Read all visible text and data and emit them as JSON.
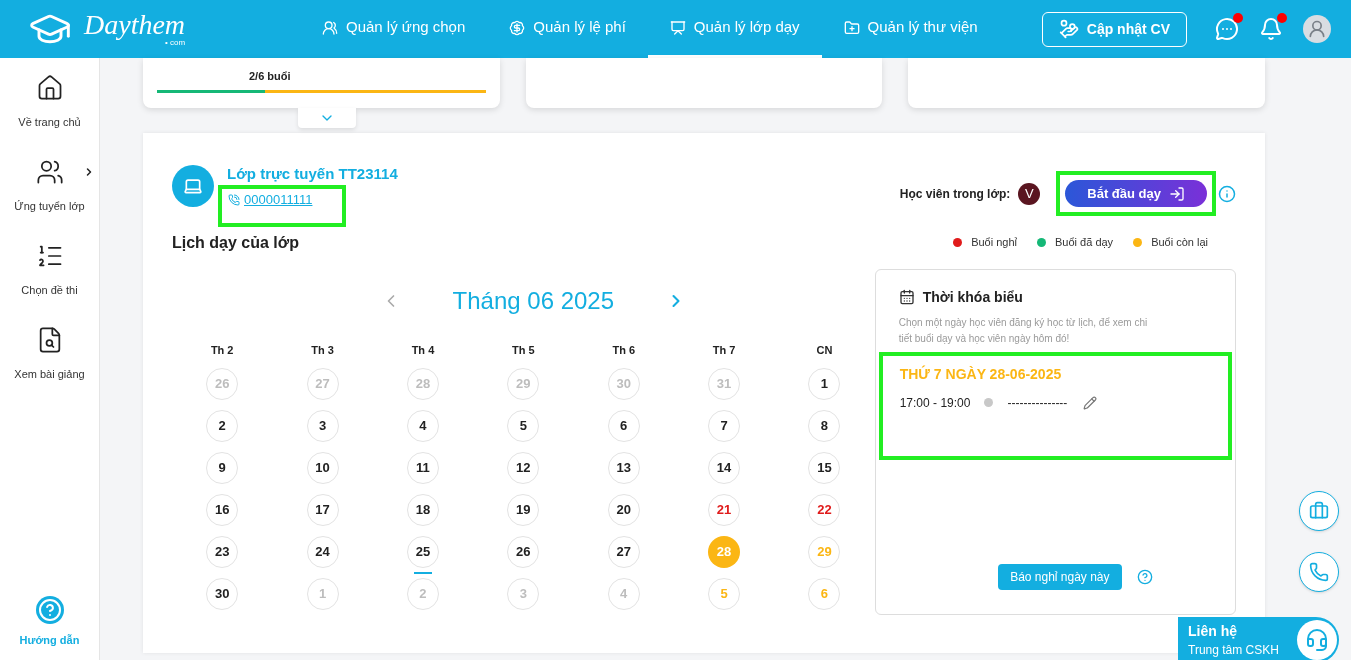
{
  "header": {
    "logo": "Daythem",
    "logo_suffix": "• com",
    "nav": [
      {
        "label": "Quản lý ứng chọn",
        "selected": false
      },
      {
        "label": "Quản lý lệ phí",
        "selected": false
      },
      {
        "label": "Quản lý lớp dạy",
        "selected": true
      },
      {
        "label": "Quản lý thư viện",
        "selected": false
      }
    ],
    "cv_button": "Cập nhật CV",
    "chat_unread": true,
    "bell_unread": true
  },
  "sidebar": {
    "items": [
      {
        "label": "Về trang chủ",
        "expandable": false
      },
      {
        "label": "Ứng tuyển lớp",
        "expandable": true
      },
      {
        "label": "Chọn đề thi",
        "expandable": false
      },
      {
        "label": "Xem bài giảng",
        "expandable": false
      }
    ],
    "help": "Hướng dẫn"
  },
  "top_cards": [
    {
      "kind": "progress",
      "label": "2/6 buổi",
      "level": 0.33
    },
    {
      "kind": "empty"
    },
    {
      "kind": "empty"
    }
  ],
  "class": {
    "title": "Lớp trực tuyến TT23114",
    "phone": "0000011111",
    "phone_highlighted": true,
    "students_label": "Học viên trong lớp:",
    "students": [
      {
        "initial": "V",
        "color": "#5a1520"
      }
    ],
    "start_button": "Bắt đầu dạy",
    "start_highlighted": true
  },
  "schedule": {
    "title": "Lịch dạy của lớp",
    "legend": [
      {
        "label": "Buổi nghỉ",
        "color": "#e01b1b"
      },
      {
        "label": "Buổi đã dạy",
        "color": "#15b877"
      },
      {
        "label": "Buổi còn lại",
        "color": "#fbb614"
      }
    ],
    "month": "Tháng 06 2025",
    "weekdays": [
      "Th 2",
      "Th 3",
      "Th 4",
      "Th 5",
      "Th 6",
      "Th 7",
      "CN"
    ],
    "days": [
      {
        "day": "26",
        "kind": "outside",
        "selected": false
      },
      {
        "day": "27",
        "kind": "outside",
        "selected": false
      },
      {
        "day": "28",
        "kind": "outside",
        "selected": false
      },
      {
        "day": "29",
        "kind": "outside",
        "selected": false
      },
      {
        "day": "30",
        "kind": "outside",
        "selected": false
      },
      {
        "day": "31",
        "kind": "outside",
        "selected": false
      },
      {
        "day": "1",
        "kind": "normal",
        "selected": false
      },
      {
        "day": "2",
        "kind": "normal",
        "selected": false
      },
      {
        "day": "3",
        "kind": "normal",
        "selected": false
      },
      {
        "day": "4",
        "kind": "normal",
        "selected": false
      },
      {
        "day": "5",
        "kind": "normal",
        "selected": false
      },
      {
        "day": "6",
        "kind": "normal",
        "selected": false
      },
      {
        "day": "7",
        "kind": "normal",
        "selected": false
      },
      {
        "day": "8",
        "kind": "normal",
        "selected": false
      },
      {
        "day": "9",
        "kind": "normal",
        "selected": false
      },
      {
        "day": "10",
        "kind": "normal",
        "selected": false
      },
      {
        "day": "11",
        "kind": "normal",
        "selected": false
      },
      {
        "day": "12",
        "kind": "normal",
        "selected": false
      },
      {
        "day": "13",
        "kind": "normal",
        "selected": false
      },
      {
        "day": "14",
        "kind": "normal",
        "selected": false
      },
      {
        "day": "15",
        "kind": "normal",
        "selected": false
      },
      {
        "day": "16",
        "kind": "normal",
        "selected": false
      },
      {
        "day": "17",
        "kind": "normal",
        "selected": false
      },
      {
        "day": "18",
        "kind": "normal",
        "selected": false
      },
      {
        "day": "19",
        "kind": "normal",
        "selected": false
      },
      {
        "day": "20",
        "kind": "normal",
        "selected": false
      },
      {
        "day": "21",
        "kind": "absent",
        "selected": false
      },
      {
        "day": "22",
        "kind": "absent",
        "selected": false
      },
      {
        "day": "23",
        "kind": "normal",
        "selected": false
      },
      {
        "day": "24",
        "kind": "normal",
        "selected": false
      },
      {
        "day": "25",
        "kind": "today",
        "selected": false
      },
      {
        "day": "26",
        "kind": "normal",
        "selected": false
      },
      {
        "day": "27",
        "kind": "normal",
        "selected": false
      },
      {
        "day": "28",
        "kind": "remaining",
        "selected": true
      },
      {
        "day": "29",
        "kind": "remaining",
        "selected": false
      },
      {
        "day": "30",
        "kind": "normal",
        "selected": false
      },
      {
        "day": "1",
        "kind": "outside",
        "selected": false
      },
      {
        "day": "2",
        "kind": "outside",
        "selected": false
      },
      {
        "day": "3",
        "kind": "outside",
        "selected": false
      },
      {
        "day": "4",
        "kind": "outside",
        "selected": false
      },
      {
        "day": "5",
        "kind": "outside-remaining",
        "selected": false
      },
      {
        "day": "6",
        "kind": "outside-remaining",
        "selected": false
      }
    ]
  },
  "timetable": {
    "title": "Thời khóa biểu",
    "hint": "Chọn một ngày học viên đăng ký học từ lịch, để xem chi tiết buổi dạy và học viên ngày hôm đó!",
    "date_heading": "THỨ 7 NGÀY 28-06-2025",
    "highlighted": true,
    "sessions": [
      {
        "time": "17:00 - 19:00",
        "color": "#c8c8c8",
        "teacher": "---------------"
      }
    ],
    "leave_button": "Báo nghỉ ngày này"
  },
  "contact": {
    "title": "Liên hệ",
    "subtitle": "Trung tâm CSKH"
  }
}
